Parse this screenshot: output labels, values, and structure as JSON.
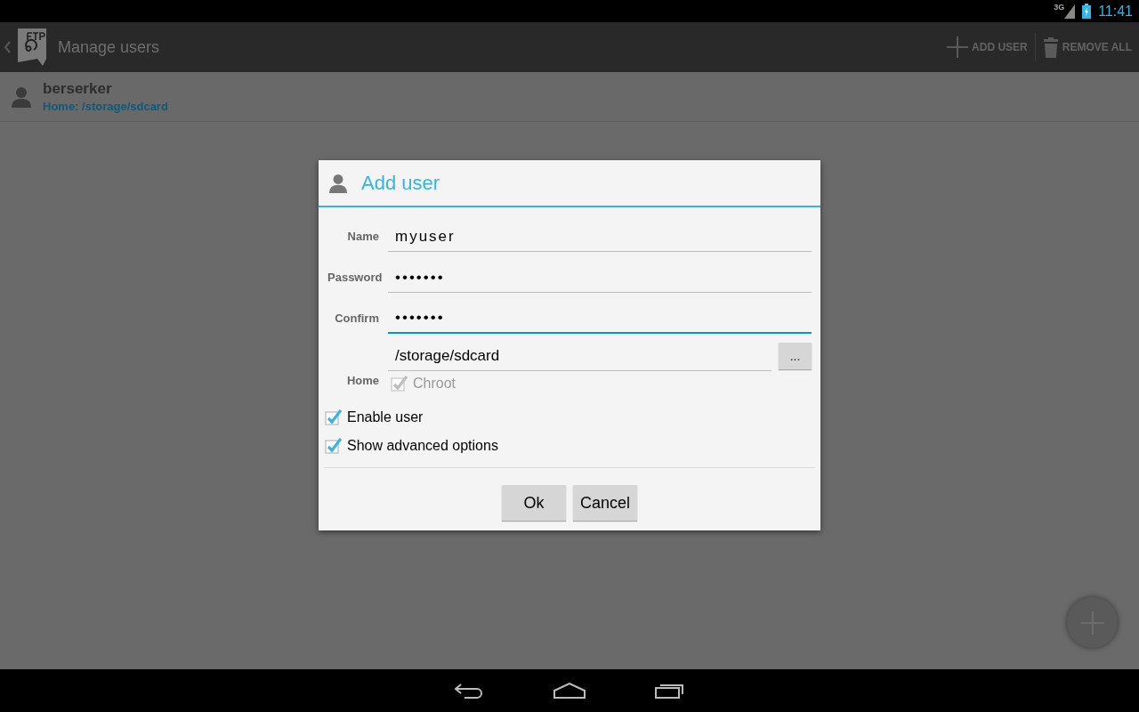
{
  "status_bar": {
    "network": "3G",
    "time": "11:41"
  },
  "action_bar": {
    "title": "Manage users",
    "actions": [
      {
        "kind": "add",
        "label": "ADD USER"
      },
      {
        "kind": "delete",
        "label": "REMOVE ALL"
      }
    ]
  },
  "users": [
    {
      "name": "berserker",
      "home": "Home: /storage/sdcard"
    }
  ],
  "dialog": {
    "title": "Add user",
    "fields": [
      {
        "label": "Name",
        "value": "myuser",
        "focused": false
      },
      {
        "label": "Password",
        "value": "•••••••",
        "focused": false
      },
      {
        "label": "Confirm",
        "value": "•••••••",
        "focused": true
      }
    ],
    "home": {
      "label": "Home",
      "value": "/storage/sdcard",
      "browse": "..."
    },
    "chroot": {
      "label": "Chroot",
      "checked": true,
      "disabled": true
    },
    "options": [
      {
        "label": "Enable user",
        "checked": true
      },
      {
        "label": "Show advanced options",
        "checked": true
      }
    ],
    "buttons": [
      "Ok",
      "Cancel"
    ]
  }
}
